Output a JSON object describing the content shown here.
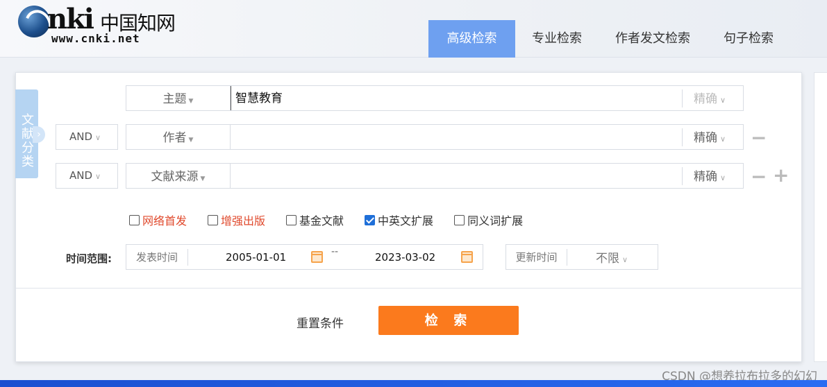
{
  "logo": {
    "nki": "nki",
    "cn": "中国知网",
    "url": "www.cnki.net"
  },
  "tabs": [
    {
      "label": "高级检索",
      "active": true
    },
    {
      "label": "专业检索",
      "active": false
    },
    {
      "label": "作者发文检索",
      "active": false
    },
    {
      "label": "句子检索",
      "active": false
    }
  ],
  "side_tab": {
    "label": "文献分类"
  },
  "rows": [
    {
      "logic": "",
      "field": "主题",
      "value": "智慧教育",
      "match": "精确"
    },
    {
      "logic": "AND",
      "field": "作者",
      "value": "",
      "match": "精确"
    },
    {
      "logic": "AND",
      "field": "文献来源",
      "value": "",
      "match": "精确"
    }
  ],
  "row_buttons": {
    "minus": "−",
    "plus": "+"
  },
  "checkboxes": [
    {
      "label": "网络首发",
      "checked": false,
      "color": "#e0492c"
    },
    {
      "label": "增强出版",
      "checked": false,
      "color": "#e0492c"
    },
    {
      "label": "基金文献",
      "checked": false,
      "color": "#333333"
    },
    {
      "label": "中英文扩展",
      "checked": true,
      "color": "#333333"
    },
    {
      "label": "同义词扩展",
      "checked": false,
      "color": "#333333"
    }
  ],
  "time": {
    "label": "时间范围:",
    "type": "发表时间",
    "from": "2005-01-01",
    "separator": "--",
    "to": "2023-03-02",
    "update_label": "更新时间",
    "update_value": "不限"
  },
  "actions": {
    "reset": "重置条件",
    "search": "检 索"
  },
  "watermark": "CSDN @想养拉布拉多的幻幻",
  "colors": {
    "tab_active": "#6ea0f0",
    "search_button": "#fb7a1d",
    "checkbox_on": "#1f6fd8"
  }
}
